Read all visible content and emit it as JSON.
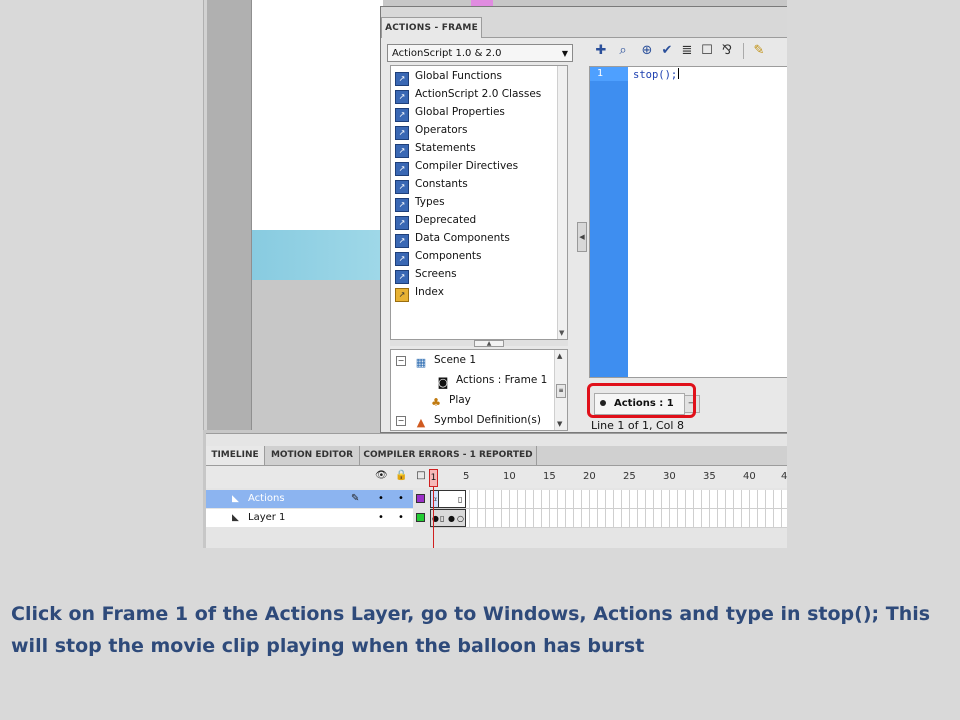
{
  "actions_panel": {
    "title": "ACTIONS - FRAME",
    "version_select": "ActionScript 1.0 & 2.0",
    "toolbar_icons": [
      "add-script-icon",
      "find-icon",
      "target-path-icon",
      "check-syntax-icon",
      "auto-format-icon",
      "code-hint-icon",
      "debug-options-icon",
      "script-assist-icon"
    ],
    "toolbox": [
      {
        "label": "Global Functions"
      },
      {
        "label": "ActionScript 2.0 Classes"
      },
      {
        "label": "Global Properties"
      },
      {
        "label": "Operators"
      },
      {
        "label": "Statements"
      },
      {
        "label": "Compiler Directives"
      },
      {
        "label": "Constants"
      },
      {
        "label": "Types"
      },
      {
        "label": "Deprecated"
      },
      {
        "label": "Data Components"
      },
      {
        "label": "Components"
      },
      {
        "label": "Screens"
      },
      {
        "label": "Index"
      }
    ],
    "navigator": {
      "scene": "Scene 1",
      "current": "Actions : Frame 1",
      "play": "Play",
      "symbols": "Symbol Definition(s)"
    },
    "editor": {
      "line_number": "1",
      "code": "stop();"
    },
    "script_tab": "Actions : 1",
    "status": "Line 1 of 1, Col 8"
  },
  "timeline": {
    "tabs": [
      "TIMELINE",
      "MOTION EDITOR",
      "COMPILER ERRORS - 1 REPORTED"
    ],
    "frame_numbers": [
      "1",
      "5",
      "10",
      "15",
      "20",
      "25",
      "30",
      "35",
      "40",
      "4"
    ],
    "layers": [
      {
        "name": "Actions",
        "selected": true,
        "color": "#9b30c8"
      },
      {
        "name": "Layer 1",
        "selected": false,
        "color": "#22cc33"
      }
    ]
  },
  "caption": "Click on Frame 1 of the Actions Layer, go to Windows, Actions and type in stop(); This will stop the movie clip playing when the balloon has burst",
  "colors": {
    "caption": "#2e4a7a",
    "highlight": "#e0101a",
    "gutter": "#3e8ef0"
  }
}
